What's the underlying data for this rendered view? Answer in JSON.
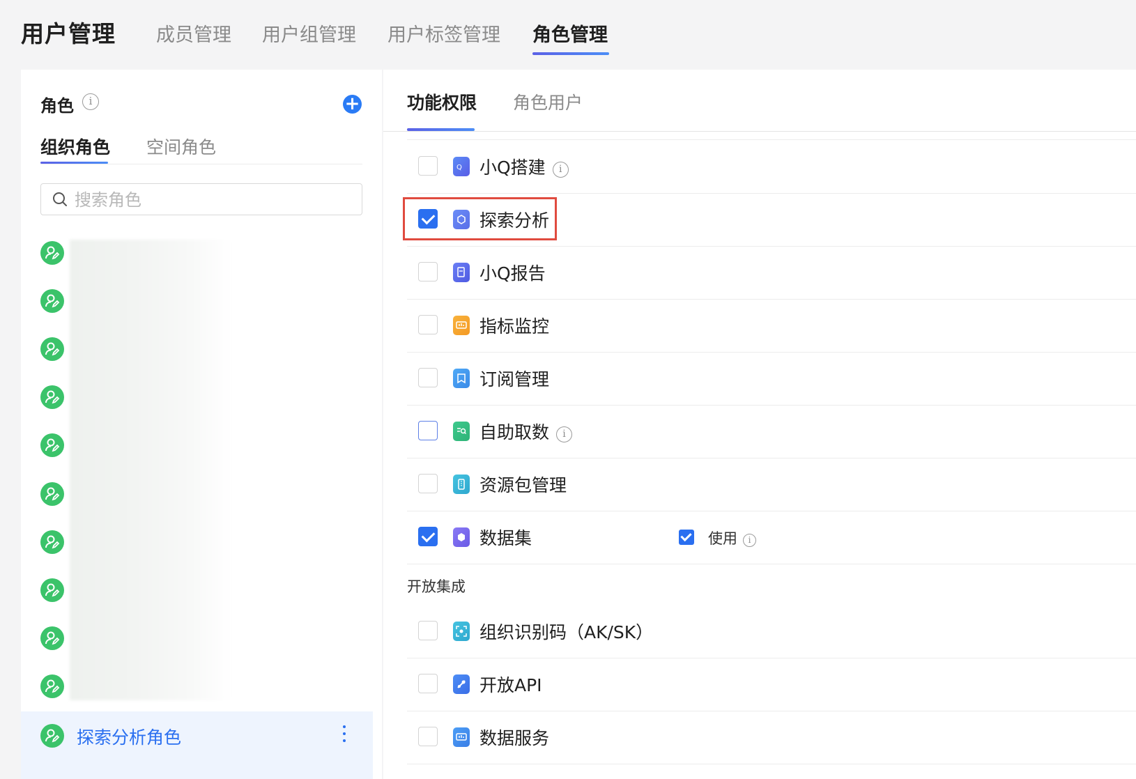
{
  "header": {
    "title": "用户管理",
    "tabs": [
      {
        "label": "成员管理"
      },
      {
        "label": "用户组管理"
      },
      {
        "label": "用户标签管理"
      },
      {
        "label": "角色管理"
      }
    ]
  },
  "left": {
    "title": "角色",
    "tabs": [
      {
        "label": "组织角色"
      },
      {
        "label": "空间角色"
      }
    ],
    "search_placeholder": "搜索角色",
    "selected_role": "探索分析角色"
  },
  "right": {
    "tabs": [
      {
        "label": "功能权限"
      },
      {
        "label": "角色用户"
      }
    ],
    "permissions": [
      {
        "label": "小Q搭建",
        "checked": false
      },
      {
        "label": "探索分析",
        "checked": true
      },
      {
        "label": "小Q报告",
        "checked": false
      },
      {
        "label": "指标监控",
        "checked": false
      },
      {
        "label": "订阅管理",
        "checked": false
      },
      {
        "label": "自助取数",
        "checked": false
      },
      {
        "label": "资源包管理",
        "checked": false
      },
      {
        "label": "数据集",
        "checked": true,
        "sub_option": {
          "label": "使用",
          "checked": true
        }
      }
    ],
    "section_title": "开放集成",
    "integrations": [
      {
        "label": "组织识别码（AK/SK）",
        "checked": false
      },
      {
        "label": "开放API",
        "checked": false
      },
      {
        "label": "数据服务",
        "checked": false
      }
    ]
  },
  "colors": {
    "accent": "#2a6ff0",
    "avatar": "#3bc36a",
    "highlight": "#e04b3f"
  }
}
